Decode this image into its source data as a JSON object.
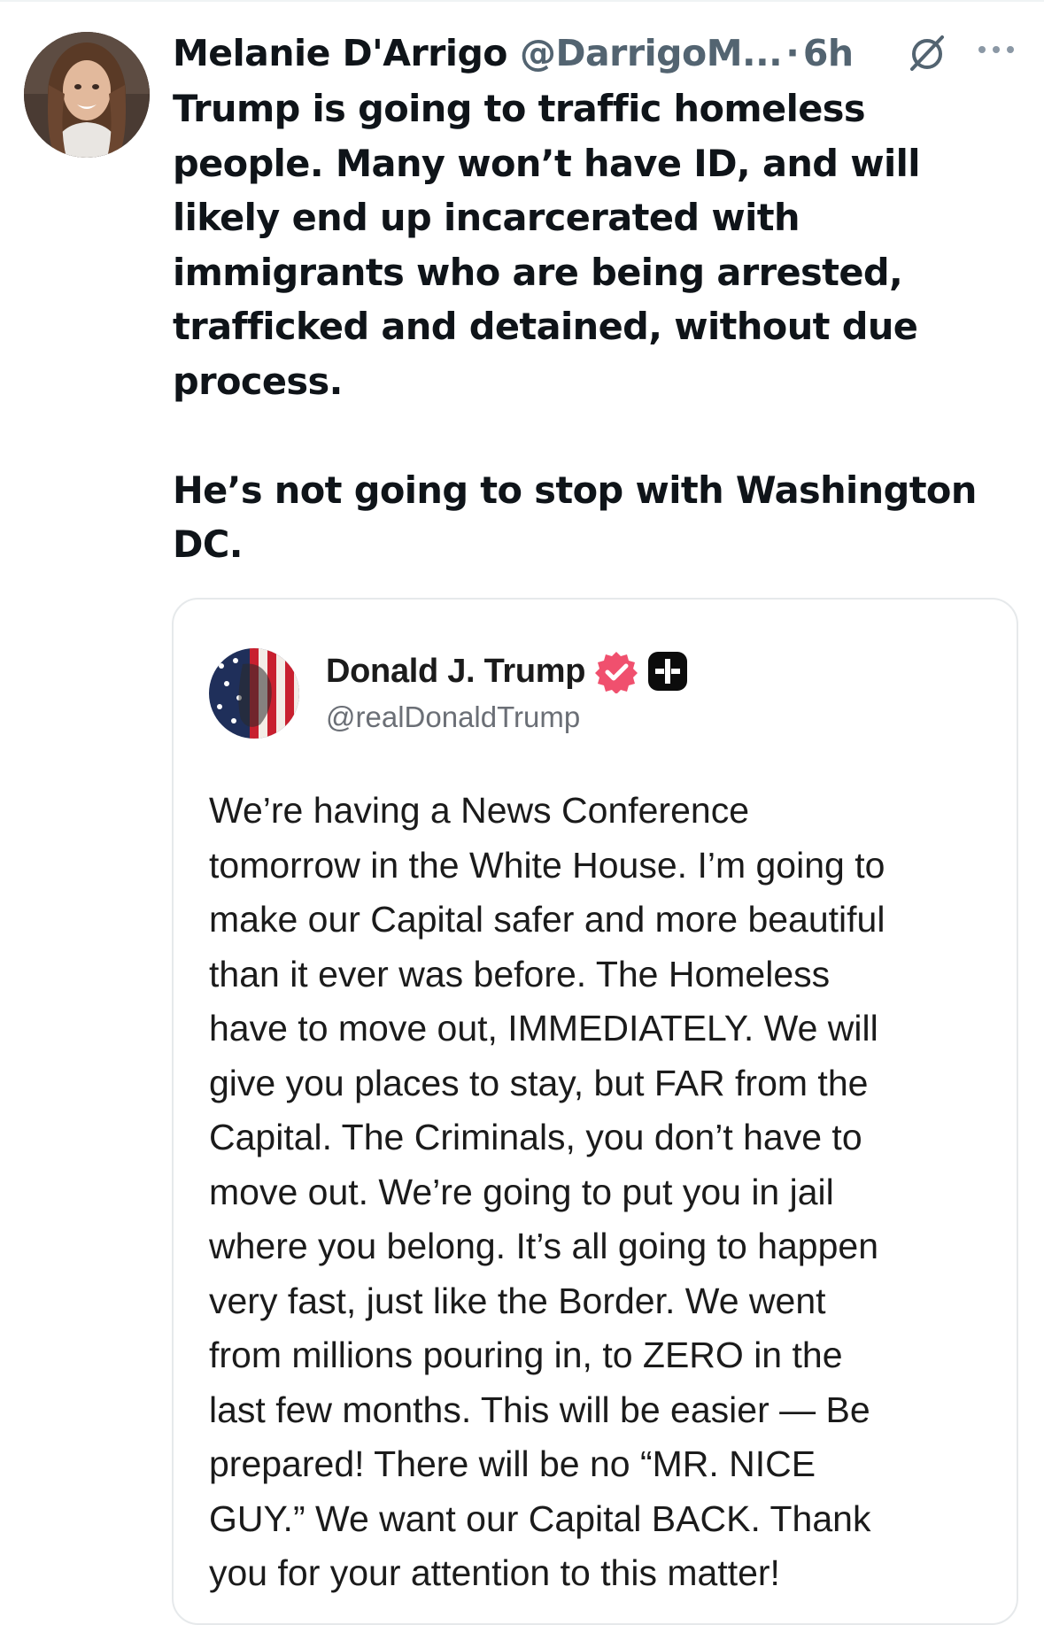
{
  "tweet": {
    "display_name": "Melanie D'Arrigo",
    "handle": "@DarrigoM...",
    "separator": "·",
    "time": "6h",
    "avatar_icon": "profile-photo",
    "text": "Trump is going to traffic homeless\npeople. Many won’t have ID, and will\nlikely end up incarcerated with\nimmigrants who are being arrested,\ntrafficked and detained, without due\nprocess.\n\nHe’s not going to stop with Washington\nDC."
  },
  "actions": {
    "grok_icon": "grok-icon",
    "more_icon": "more-options-icon"
  },
  "quoted_post": {
    "display_name": "Donald J. Trump",
    "handle": "@realDonaldTrump",
    "verified_icon": "verified-badge-icon",
    "plus_icon": "plus-badge-icon",
    "text": "We’re having a News Conference\ntomorrow in the White House. I’m going to\nmake our Capital safer and more beautiful\nthan it ever was before. The Homeless\nhave to move out, IMMEDIATELY. We will\ngive you places to stay, but FAR from the\nCapital. The Criminals, you don’t have to\nmove out. We’re going to put you in jail\nwhere you belong. It’s all going to happen\nvery fast, just like the Border. We went\nfrom millions pouring in, to ZERO in the\nlast few months. This will be easier — Be\nprepared! There will be no “MR. NICE\nGUY.” We want our Capital BACK. Thank\nyou for your attention to this matter!"
  },
  "colors": {
    "primary_text": "#0f1419",
    "secondary_text": "#536471",
    "verified_badge": "#f0506e",
    "card_border": "#e6e9eb"
  }
}
